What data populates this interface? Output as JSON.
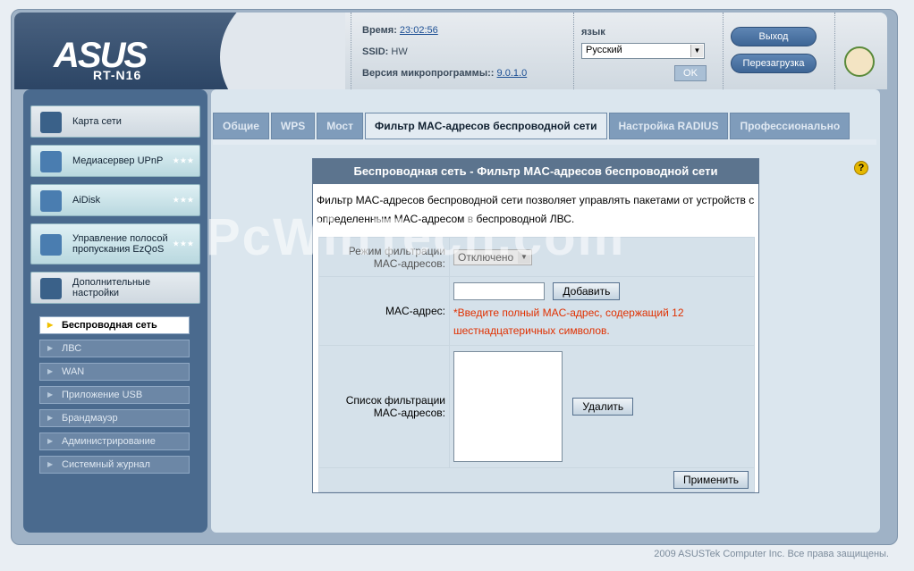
{
  "header": {
    "logo": "ASUS",
    "model": "RT-N16",
    "time_label": "Время:",
    "time_value": "23:02:56",
    "ssid_label": "SSID:",
    "ssid_value": "HW",
    "firmware_label": "Версия микропрограммы::",
    "firmware_value": "9.0.1.0",
    "language_label": "язык",
    "language_value": "Русский",
    "ok_label": "OK",
    "logout_label": "Выход",
    "reboot_label": "Перезагрузка"
  },
  "sidebar": {
    "items": [
      {
        "label": "Карта сети",
        "icon": "network-map-icon"
      },
      {
        "label": "Медиасервер UPnP",
        "icon": "media-server-icon",
        "stars": "★★★"
      },
      {
        "label": "AiDisk",
        "icon": "aidisk-icon",
        "stars": "★★★"
      },
      {
        "label": "Управление полосой пропускания EzQoS",
        "icon": "qos-icon",
        "stars": "★★★"
      },
      {
        "label": "Дополнительные настройки",
        "icon": "tools-icon"
      }
    ],
    "subitems": [
      {
        "label": "Беспроводная сеть",
        "active": true
      },
      {
        "label": "ЛВС"
      },
      {
        "label": "WAN"
      },
      {
        "label": "Приложение USB"
      },
      {
        "label": "Брандмауэр"
      },
      {
        "label": "Администрирование"
      },
      {
        "label": "Системный журнал"
      }
    ]
  },
  "tabs": [
    {
      "label": "Общие"
    },
    {
      "label": "WPS"
    },
    {
      "label": "Мост"
    },
    {
      "label": "Фильтр MAC-адресов беспроводной сети",
      "active": true
    },
    {
      "label": "Настройка RADIUS"
    },
    {
      "label": "Профессионально"
    }
  ],
  "panel": {
    "title": "Беспроводная сеть - Фильтр MAC-адресов беспроводной сети",
    "description": "Фильтр MAC-адресов беспроводной сети позволяет управлять пакетами от устройств с определенным MAC-адресом в беспроводной ЛВС.",
    "mode_label": "Режим фильтрации MAC-адресов:",
    "mode_value": "Отключено",
    "mac_label": "MAC-адрес:",
    "mac_value": "",
    "add_label": "Добавить",
    "mac_hint": "*Введите полный MAC-адрес, содержащий 12 шестнадцатеричных символов.",
    "list_label": "Список фильтрации MAC-адресов:",
    "delete_label": "Удалить",
    "apply_label": "Применить"
  },
  "watermark": "PcWinTech.com",
  "footer": "2009 ASUSTek Computer Inc. Все права защищены."
}
